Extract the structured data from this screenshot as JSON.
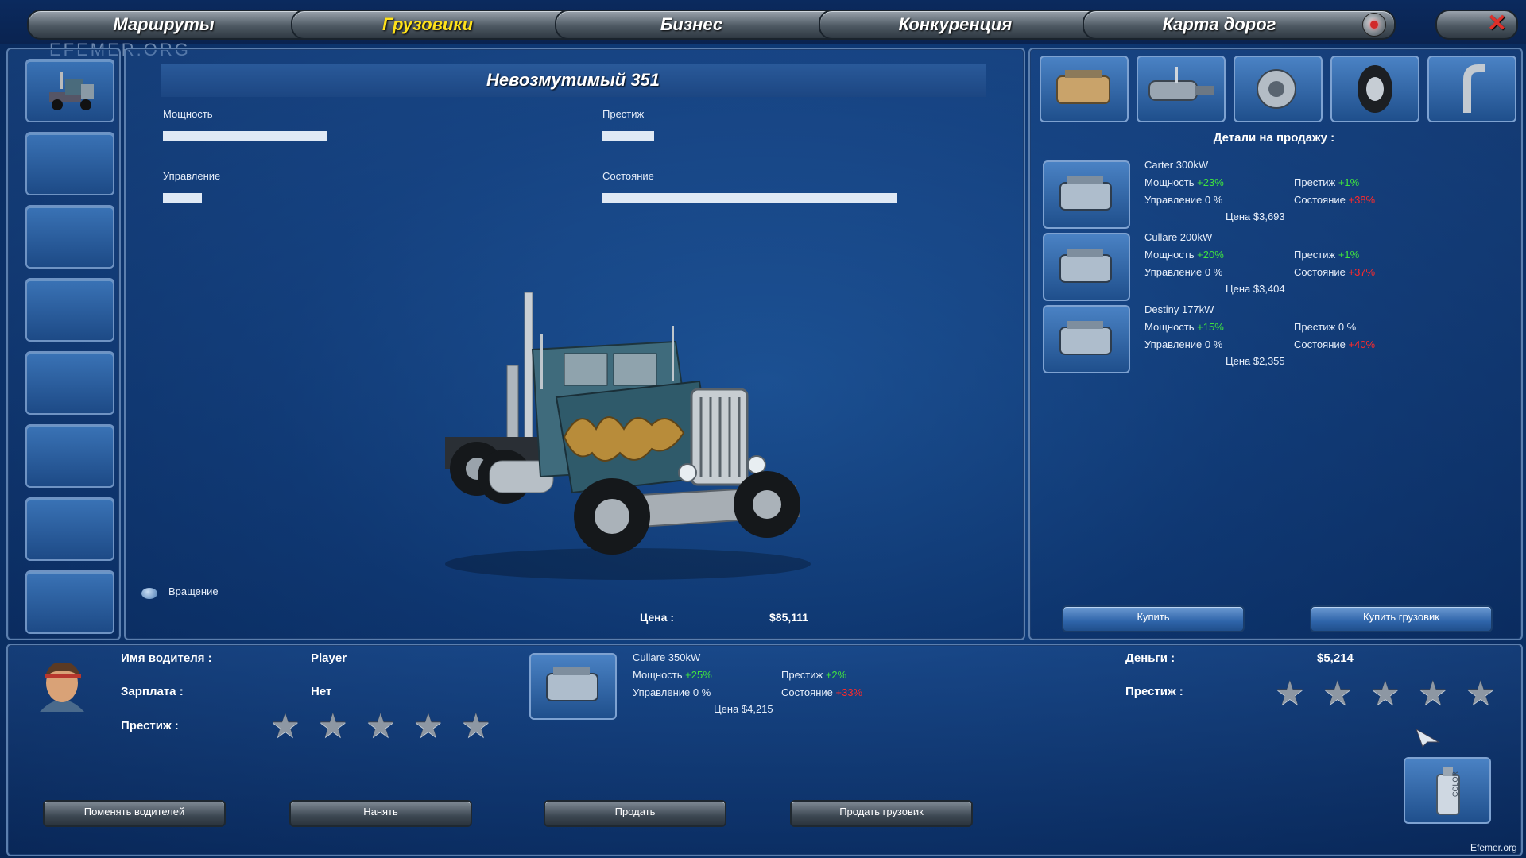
{
  "nav": {
    "tabs": [
      {
        "label": "Маршруты",
        "active": false
      },
      {
        "label": "Грузовики",
        "active": true
      },
      {
        "label": "Бизнес",
        "active": false
      },
      {
        "label": "Конкуренция",
        "active": false
      },
      {
        "label": "Карта дорог",
        "active": false
      }
    ],
    "watermark": "EFEMER.ORG"
  },
  "truck": {
    "name": "Невозмутимый 351",
    "stats": [
      {
        "label": "Мощность",
        "value_percent": 38
      },
      {
        "label": "Престиж",
        "value_percent": 12
      },
      {
        "label": "Управление",
        "value_percent": 9
      },
      {
        "label": "Состояние",
        "value_percent": 68
      }
    ],
    "rotation_label": "Вращение",
    "price_label": "Цена :",
    "price_value": "$85,111"
  },
  "parts_panel": {
    "heading": "Детали на продажу :",
    "categories": [
      "engine-icon",
      "transmission-icon",
      "turbo-icon",
      "tire-icon",
      "exhaust-icon"
    ],
    "items": [
      {
        "name": "Carter 300kW",
        "power_label": "Мощность",
        "power": "+23%",
        "prestige_label": "Престиж",
        "prestige": "+1%",
        "control_label": "Управление",
        "control": "0 %",
        "condition_label": "Состояние",
        "condition": "+38%",
        "price": "Цена $3,693"
      },
      {
        "name": "Cullare 200kW",
        "power_label": "Мощность",
        "power": "+20%",
        "prestige_label": "Престиж",
        "prestige": "+1%",
        "control_label": "Управление",
        "control": "0 %",
        "condition_label": "Состояние",
        "condition": "+37%",
        "price": "Цена $3,404"
      },
      {
        "name": "Destiny 177kW",
        "power_label": "Мощность",
        "power": "+15%",
        "prestige_label": "Престиж",
        "prestige": "0 %",
        "control_label": "Управление",
        "control": "0 %",
        "condition_label": "Состояние",
        "condition": "+40%",
        "price": "Цена $2,355"
      }
    ],
    "buy_label": "Купить",
    "buy_truck_label": "Купить грузовик"
  },
  "driver": {
    "name_label": "Имя водителя :",
    "name_value": "Player",
    "salary_label": "Зарплата :",
    "salary_value": "Нет",
    "prestige_label": "Престиж :",
    "prestige_stars": 0
  },
  "installed_part": {
    "name": "Cullare 350kW",
    "power_label": "Мощность",
    "power": "+25%",
    "prestige_label": "Престиж",
    "prestige": "+2%",
    "control_label": "Управление",
    "control": "0 %",
    "condition_label": "Состояние",
    "condition": "+33%",
    "price": "Цена $4,215"
  },
  "company": {
    "money_label": "Деньги :",
    "money_value": "$5,214",
    "prestige_label": "Престиж :",
    "prestige_stars": 0,
    "paint_label": "COLOR"
  },
  "bottom_buttons": {
    "change_drivers": "Поменять водителей",
    "hire": "Нанять",
    "sell": "Продать",
    "sell_truck": "Продать грузовик"
  },
  "footer_watermark": "Efemer.org",
  "colors": {
    "positive": "#3fe33f",
    "negative": "#ff2a2a",
    "active_tab": "#ffe21a"
  }
}
